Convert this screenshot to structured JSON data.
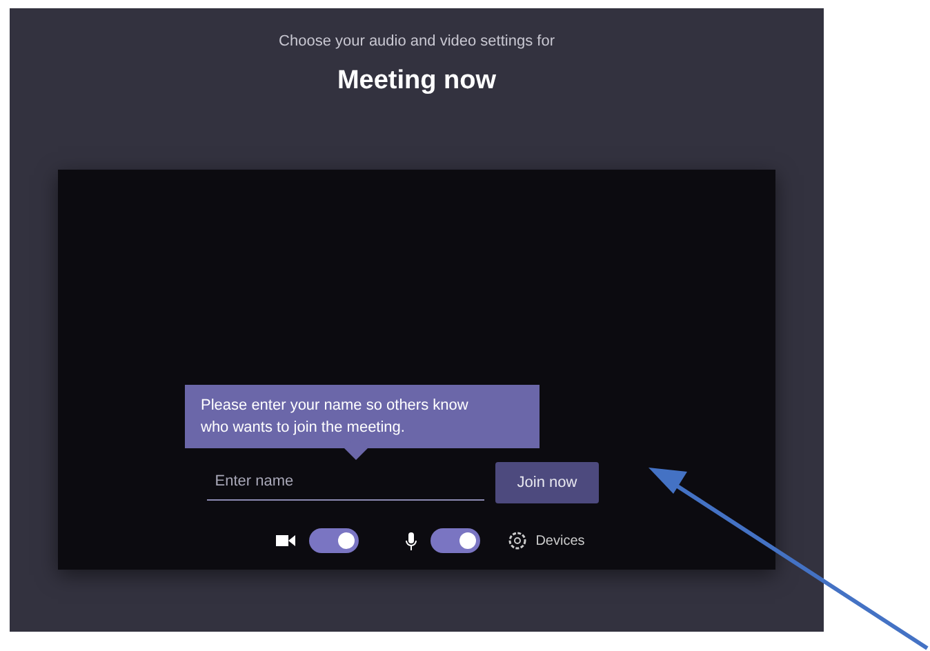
{
  "header": {
    "subtitle": "Choose your audio and video settings for",
    "title": "Meeting now"
  },
  "tooltip": {
    "text": "Please enter your name so others know who wants to join the meeting."
  },
  "name_field": {
    "placeholder": "Enter name"
  },
  "join_button": {
    "label": "Join now"
  },
  "toggles": [
    {
      "kind": "camera",
      "on": true
    },
    {
      "kind": "microphone",
      "on": true
    }
  ],
  "devices": {
    "label": "Devices"
  }
}
